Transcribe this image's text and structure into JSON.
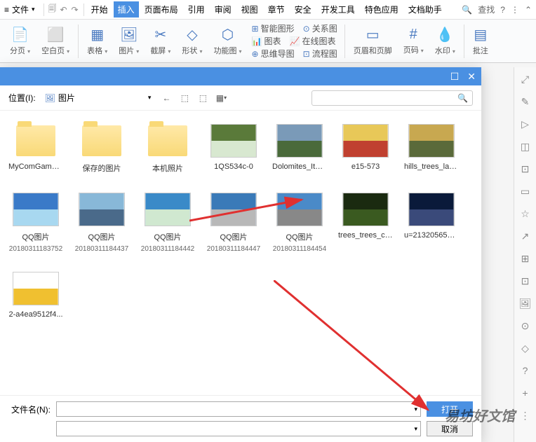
{
  "topbar": {
    "file": "文件",
    "tabs": [
      "开始",
      "插入",
      "页面布局",
      "引用",
      "审阅",
      "视图",
      "章节",
      "安全",
      "开发工具",
      "特色应用",
      "文档助手"
    ],
    "active": 1,
    "search": "查找"
  },
  "ribbon": {
    "groups": [
      {
        "icon": "📄",
        "label": "分页",
        "dd": true
      },
      {
        "icon": "⬜",
        "label": "空白页",
        "dd": true
      }
    ],
    "groups2": [
      {
        "icon": "▦",
        "label": "表格",
        "dd": true
      },
      {
        "icon": "🖼",
        "label": "图片",
        "dd": true
      },
      {
        "icon": "✂",
        "label": "截屏",
        "dd": true
      },
      {
        "icon": "◇",
        "label": "形状",
        "dd": true
      },
      {
        "icon": "⬡",
        "label": "功能图",
        "dd": true
      }
    ],
    "mini": [
      {
        "icon": "⊞",
        "label": "智能图形"
      },
      {
        "icon": "⊙",
        "label": "关系图"
      },
      {
        "icon": "📊",
        "label": "图表"
      },
      {
        "icon": "📈",
        "label": "在线图表"
      },
      {
        "icon": "⊕",
        "label": "思维导图"
      },
      {
        "icon": "⊡",
        "label": "流程图"
      }
    ],
    "groups3": [
      {
        "icon": "▭",
        "label": "页眉和页脚"
      },
      {
        "icon": "#",
        "label": "页码",
        "dd": true
      },
      {
        "icon": "💧",
        "label": "水印",
        "dd": true
      }
    ],
    "groups4": [
      {
        "icon": "▤",
        "label": "批注"
      }
    ]
  },
  "dialog": {
    "location_label": "位置(I):",
    "location_value": "图片",
    "search_placeholder": "",
    "filename_label": "文件名(N):",
    "filename_value": "",
    "open": "打开",
    "cancel": "取消",
    "files": [
      {
        "type": "folder",
        "name": "MyComGameC..."
      },
      {
        "type": "folder",
        "name": "保存的图片"
      },
      {
        "type": "folder",
        "name": "本机照片"
      },
      {
        "type": "img",
        "name": "1QS534c-0",
        "c1": "#5a7a3a",
        "c2": "#d8e8d0"
      },
      {
        "type": "img",
        "name": "Dolomites_Italy...",
        "c1": "#7a9ab8",
        "c2": "#4a6a3a"
      },
      {
        "type": "img",
        "name": "e15-573",
        "c1": "#e8c858",
        "c2": "#c04030"
      },
      {
        "type": "img",
        "name": "hills_trees_lands...",
        "c1": "#c8a850",
        "c2": "#5a6a3a"
      },
      {
        "type": "img",
        "name": "QQ图片",
        "sub": "20180311183752",
        "c1": "#3a7ac8",
        "c2": "#a8d8f0"
      },
      {
        "type": "img",
        "name": "QQ图片",
        "sub": "20180311184437",
        "c1": "#88b8d8",
        "c2": "#4a6a8a"
      },
      {
        "type": "img",
        "name": "QQ图片",
        "sub": "20180311184442",
        "c1": "#3a8ac8",
        "c2": "#d0e8d0"
      },
      {
        "type": "img",
        "name": "QQ图片",
        "sub": "20180311184447",
        "c1": "#3a7ab8",
        "c2": "#b8b8b8"
      },
      {
        "type": "img",
        "name": "QQ图片",
        "sub": "20180311184454",
        "c1": "#4a8ac8",
        "c2": "#888888"
      },
      {
        "type": "img",
        "name": "trees_trees_cre...",
        "c1": "#1a2a10",
        "c2": "#3a5a20"
      },
      {
        "type": "img",
        "name": "u=2132056592...",
        "c1": "#0a1a3a",
        "c2": "#3a4a7a"
      },
      {
        "type": "img",
        "name": "2-a4ea9512f4...",
        "c1": "#ffffff",
        "c2": "#f0c030"
      }
    ]
  },
  "side": [
    "⤢",
    "✎",
    "▷",
    "◫",
    "⊡",
    "▭",
    "☆",
    "↗",
    "⊞",
    "⊡",
    "🖼",
    "⊙",
    "◇",
    "?",
    "+",
    "⋮"
  ],
  "watermark": "易坊好文馆"
}
